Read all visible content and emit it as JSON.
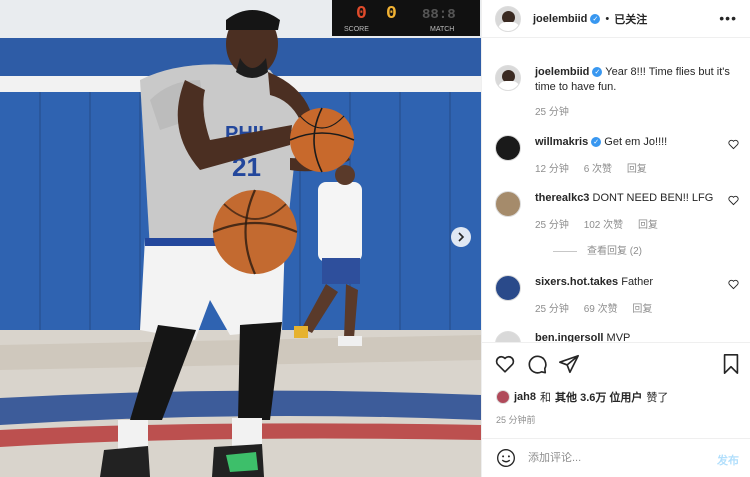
{
  "scoreboard": {
    "left_digit": "0",
    "mid_digit": "0",
    "right_digits": "88:8",
    "label_left": "SCORE",
    "label_right": "MATCH"
  },
  "photo": {
    "jersey_text": "PHIL",
    "jersey_number": "21",
    "ball_seam_color": "#1b1b1b"
  },
  "post": {
    "username": "joelembiid",
    "follow_state": "已关注",
    "caption_user": "joelembiid",
    "caption_text": "Year 8!!! Time flies but it's time to have fun.",
    "caption_time": "25 分钟"
  },
  "comments": [
    {
      "user": "willmakris",
      "verified": true,
      "text": "Get em Jo!!!!",
      "time": "12 分钟",
      "likes": "6 次赞",
      "reply": "回复"
    },
    {
      "user": "therealkc3",
      "verified": false,
      "text": "DONT NEED BEN!! LFG",
      "time": "25 分钟",
      "likes": "102 次赞",
      "reply": "回复",
      "view_replies": "查看回复 (2)"
    },
    {
      "user": "sixers.hot.takes",
      "verified": false,
      "text": "Father",
      "time": "25 分钟",
      "likes": "69 次赞",
      "reply": "回复"
    },
    {
      "user": "ben.ingersoll",
      "verified": false,
      "text": "MVP",
      "time": "",
      "likes": "",
      "reply": ""
    }
  ],
  "likes_line": {
    "user": "jah8",
    "and": "和",
    "others": "其他 3.6万 位用户",
    "suffix": "赞了"
  },
  "post_time": "25 分钟前",
  "add_comment": {
    "placeholder": "添加评论...",
    "post_label": "发布"
  },
  "colors": {
    "court_blue": "#2c5fa8",
    "verified_blue": "#3897f0",
    "post_disabled": "#b2dffc"
  }
}
